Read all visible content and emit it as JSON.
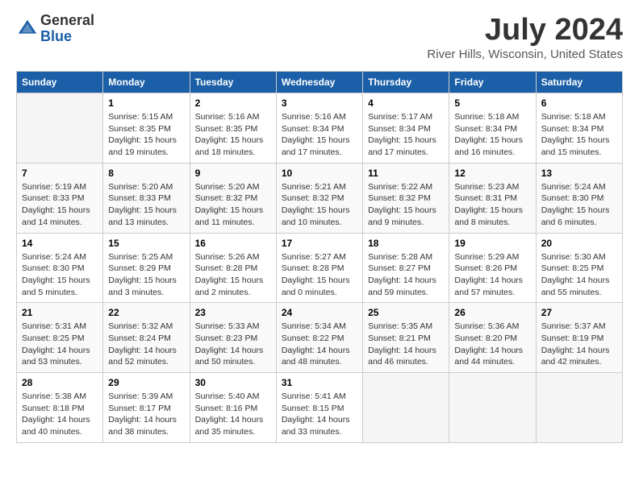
{
  "logo": {
    "general": "General",
    "blue": "Blue"
  },
  "title": "July 2024",
  "subtitle": "River Hills, Wisconsin, United States",
  "calendar": {
    "headers": [
      "Sunday",
      "Monday",
      "Tuesday",
      "Wednesday",
      "Thursday",
      "Friday",
      "Saturday"
    ],
    "weeks": [
      [
        {
          "day": "",
          "info": ""
        },
        {
          "day": "1",
          "info": "Sunrise: 5:15 AM\nSunset: 8:35 PM\nDaylight: 15 hours\nand 19 minutes."
        },
        {
          "day": "2",
          "info": "Sunrise: 5:16 AM\nSunset: 8:35 PM\nDaylight: 15 hours\nand 18 minutes."
        },
        {
          "day": "3",
          "info": "Sunrise: 5:16 AM\nSunset: 8:34 PM\nDaylight: 15 hours\nand 17 minutes."
        },
        {
          "day": "4",
          "info": "Sunrise: 5:17 AM\nSunset: 8:34 PM\nDaylight: 15 hours\nand 17 minutes."
        },
        {
          "day": "5",
          "info": "Sunrise: 5:18 AM\nSunset: 8:34 PM\nDaylight: 15 hours\nand 16 minutes."
        },
        {
          "day": "6",
          "info": "Sunrise: 5:18 AM\nSunset: 8:34 PM\nDaylight: 15 hours\nand 15 minutes."
        }
      ],
      [
        {
          "day": "7",
          "info": "Sunrise: 5:19 AM\nSunset: 8:33 PM\nDaylight: 15 hours\nand 14 minutes."
        },
        {
          "day": "8",
          "info": "Sunrise: 5:20 AM\nSunset: 8:33 PM\nDaylight: 15 hours\nand 13 minutes."
        },
        {
          "day": "9",
          "info": "Sunrise: 5:20 AM\nSunset: 8:32 PM\nDaylight: 15 hours\nand 11 minutes."
        },
        {
          "day": "10",
          "info": "Sunrise: 5:21 AM\nSunset: 8:32 PM\nDaylight: 15 hours\nand 10 minutes."
        },
        {
          "day": "11",
          "info": "Sunrise: 5:22 AM\nSunset: 8:32 PM\nDaylight: 15 hours\nand 9 minutes."
        },
        {
          "day": "12",
          "info": "Sunrise: 5:23 AM\nSunset: 8:31 PM\nDaylight: 15 hours\nand 8 minutes."
        },
        {
          "day": "13",
          "info": "Sunrise: 5:24 AM\nSunset: 8:30 PM\nDaylight: 15 hours\nand 6 minutes."
        }
      ],
      [
        {
          "day": "14",
          "info": "Sunrise: 5:24 AM\nSunset: 8:30 PM\nDaylight: 15 hours\nand 5 minutes."
        },
        {
          "day": "15",
          "info": "Sunrise: 5:25 AM\nSunset: 8:29 PM\nDaylight: 15 hours\nand 3 minutes."
        },
        {
          "day": "16",
          "info": "Sunrise: 5:26 AM\nSunset: 8:28 PM\nDaylight: 15 hours\nand 2 minutes."
        },
        {
          "day": "17",
          "info": "Sunrise: 5:27 AM\nSunset: 8:28 PM\nDaylight: 15 hours\nand 0 minutes."
        },
        {
          "day": "18",
          "info": "Sunrise: 5:28 AM\nSunset: 8:27 PM\nDaylight: 14 hours\nand 59 minutes."
        },
        {
          "day": "19",
          "info": "Sunrise: 5:29 AM\nSunset: 8:26 PM\nDaylight: 14 hours\nand 57 minutes."
        },
        {
          "day": "20",
          "info": "Sunrise: 5:30 AM\nSunset: 8:25 PM\nDaylight: 14 hours\nand 55 minutes."
        }
      ],
      [
        {
          "day": "21",
          "info": "Sunrise: 5:31 AM\nSunset: 8:25 PM\nDaylight: 14 hours\nand 53 minutes."
        },
        {
          "day": "22",
          "info": "Sunrise: 5:32 AM\nSunset: 8:24 PM\nDaylight: 14 hours\nand 52 minutes."
        },
        {
          "day": "23",
          "info": "Sunrise: 5:33 AM\nSunset: 8:23 PM\nDaylight: 14 hours\nand 50 minutes."
        },
        {
          "day": "24",
          "info": "Sunrise: 5:34 AM\nSunset: 8:22 PM\nDaylight: 14 hours\nand 48 minutes."
        },
        {
          "day": "25",
          "info": "Sunrise: 5:35 AM\nSunset: 8:21 PM\nDaylight: 14 hours\nand 46 minutes."
        },
        {
          "day": "26",
          "info": "Sunrise: 5:36 AM\nSunset: 8:20 PM\nDaylight: 14 hours\nand 44 minutes."
        },
        {
          "day": "27",
          "info": "Sunrise: 5:37 AM\nSunset: 8:19 PM\nDaylight: 14 hours\nand 42 minutes."
        }
      ],
      [
        {
          "day": "28",
          "info": "Sunrise: 5:38 AM\nSunset: 8:18 PM\nDaylight: 14 hours\nand 40 minutes."
        },
        {
          "day": "29",
          "info": "Sunrise: 5:39 AM\nSunset: 8:17 PM\nDaylight: 14 hours\nand 38 minutes."
        },
        {
          "day": "30",
          "info": "Sunrise: 5:40 AM\nSunset: 8:16 PM\nDaylight: 14 hours\nand 35 minutes."
        },
        {
          "day": "31",
          "info": "Sunrise: 5:41 AM\nSunset: 8:15 PM\nDaylight: 14 hours\nand 33 minutes."
        },
        {
          "day": "",
          "info": ""
        },
        {
          "day": "",
          "info": ""
        },
        {
          "day": "",
          "info": ""
        }
      ]
    ]
  }
}
